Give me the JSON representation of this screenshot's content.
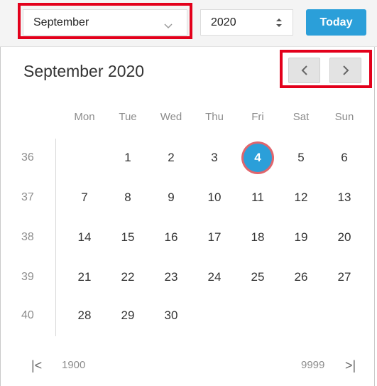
{
  "header": {
    "month_value": "September",
    "year_value": "2020",
    "today_label": "Today"
  },
  "title": "September 2020",
  "weekdays": [
    "Mon",
    "Tue",
    "Wed",
    "Thu",
    "Fri",
    "Sat",
    "Sun"
  ],
  "weeks": [
    {
      "number": "36",
      "days": [
        "",
        "1",
        "2",
        "3",
        "4",
        "5",
        "6"
      ]
    },
    {
      "number": "37",
      "days": [
        "7",
        "8",
        "9",
        "10",
        "11",
        "12",
        "13"
      ]
    },
    {
      "number": "38",
      "days": [
        "14",
        "15",
        "16",
        "17",
        "18",
        "19",
        "20"
      ]
    },
    {
      "number": "39",
      "days": [
        "21",
        "22",
        "23",
        "24",
        "25",
        "26",
        "27"
      ]
    },
    {
      "number": "40",
      "days": [
        "28",
        "29",
        "30",
        "",
        "",
        "",
        ""
      ]
    }
  ],
  "selected_day": "4",
  "footer": {
    "min_year": "1900",
    "max_year": "9999",
    "first_glyph": "|<",
    "last_glyph": ">|"
  },
  "colors": {
    "accent": "#2b9fd9",
    "highlight_box": "#e3001b",
    "today_ring": "#e0656d"
  }
}
